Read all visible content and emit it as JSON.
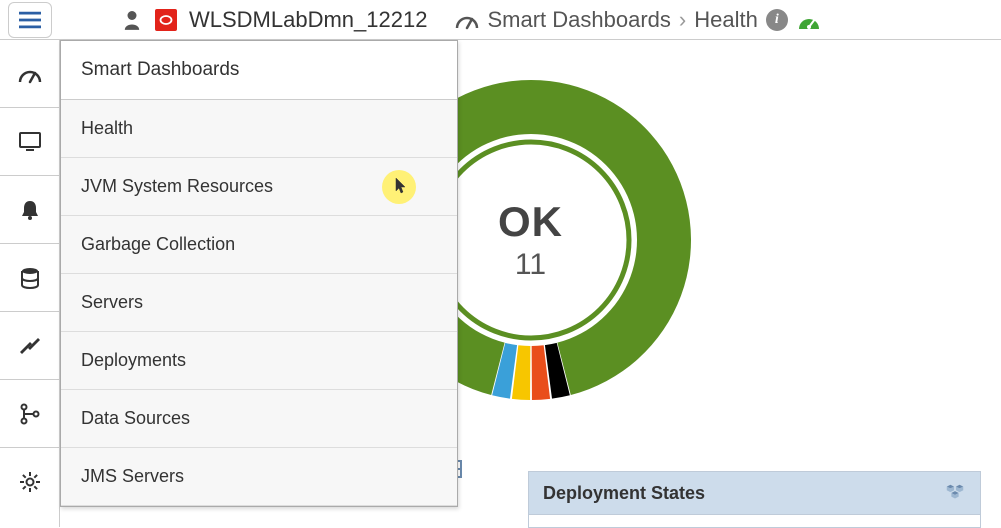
{
  "header": {
    "domain_name": "WLSDMLabDmn_12212",
    "breadcrumb_section": "Smart Dashboards",
    "breadcrumb_page": "Health"
  },
  "flyout": {
    "title": "Smart Dashboards",
    "items": [
      "Health",
      "JVM System Resources",
      "Garbage Collection",
      "Servers",
      "Deployments",
      "Data Sources",
      "JMS Servers"
    ],
    "hovered_index": 1
  },
  "rail_icons": [
    "dashboard-icon",
    "monitor-icon",
    "bell-icon",
    "database-icon",
    "tools-icon",
    "branch-icon",
    "gear-icon"
  ],
  "donut": {
    "status_label": "OK",
    "status_count": "11",
    "primary_color": "#5b8f22",
    "slice_colors": [
      "#000000",
      "#e94e1b",
      "#f7c600",
      "#3aa0d9"
    ]
  },
  "panel": {
    "title": "Deployment States"
  },
  "chart_data": {
    "type": "pie",
    "title": "Health",
    "series": [
      {
        "name": "OK",
        "value": 11,
        "color": "#5b8f22"
      },
      {
        "name": "slice-black",
        "value": 0.15,
        "color": "#000000"
      },
      {
        "name": "slice-orange",
        "value": 0.15,
        "color": "#e94e1b"
      },
      {
        "name": "slice-yellow",
        "value": 0.15,
        "color": "#f7c600"
      },
      {
        "name": "slice-blue",
        "value": 0.15,
        "color": "#3aa0d9"
      }
    ],
    "center_label": "OK",
    "center_value": 11
  }
}
